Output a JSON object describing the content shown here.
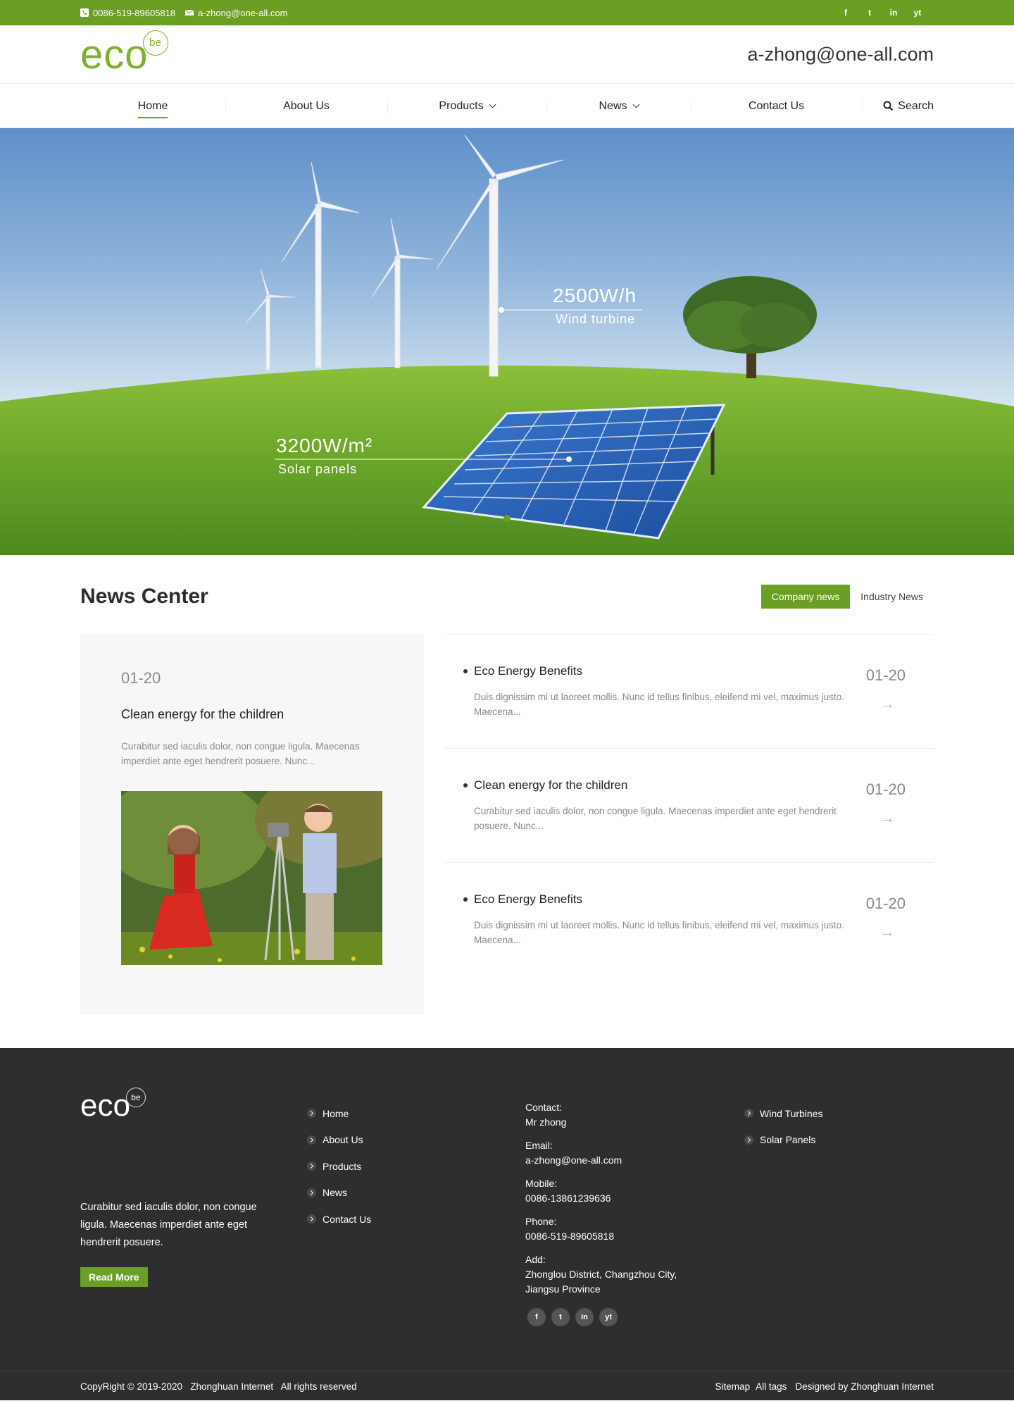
{
  "topbar": {
    "phone": "0086-519-89605818",
    "email": "a-zhong@one-all.com",
    "social": [
      "f",
      "t",
      "in",
      "yt"
    ]
  },
  "header": {
    "logo_main": "eco",
    "logo_badge": "be",
    "email": "a-zhong@one-all.com"
  },
  "nav": {
    "items": [
      {
        "label": "Home"
      },
      {
        "label": "About Us"
      },
      {
        "label": "Products"
      },
      {
        "label": "News"
      },
      {
        "label": "Contact Us"
      }
    ],
    "search_label": "Search"
  },
  "hero": {
    "wind_value": "2500W/h",
    "wind_caption": "Wind turbine",
    "solar_value": "3200W/m²",
    "solar_caption": "Solar panels"
  },
  "news": {
    "title": "News Center",
    "tabs": [
      {
        "label": "Company news"
      },
      {
        "label": "Industry News"
      }
    ],
    "featured": {
      "date": "01-20",
      "title": "Clean energy for the children",
      "desc": "Curabitur sed iaculis dolor, non congue ligula. Maecenas imperdiet ante eget hendrerit posuere. Nunc..."
    },
    "items": [
      {
        "title": "Eco Energy Benefits",
        "desc": "Duis dignissim mi ut laoreet mollis. Nunc id tellus finibus, eleifend mi vel, maximus justo. Maecena...",
        "date": "01-20",
        "arrow": "→"
      },
      {
        "title": "Clean energy for the children",
        "desc": "Curabitur sed iaculis dolor, non congue ligula. Maecenas imperdiet ante eget hendrerit posuere. Nunc...",
        "date": "01-20",
        "arrow": "→"
      },
      {
        "title": "Eco Energy Benefits",
        "desc": "Duis dignissim mi ut laoreet mollis. Nunc id tellus finibus, eleifend mi vel, maximus justo. Maecena...",
        "date": "01-20",
        "arrow": "→"
      }
    ]
  },
  "footer": {
    "logo_main": "eco",
    "logo_badge": "be",
    "about": "Curabitur sed iaculis dolor, non congue ligula. Maecenas imperdiet ante eget hendrerit posuere.",
    "read_more": "Read More",
    "links": [
      {
        "label": "Home"
      },
      {
        "label": "About Us"
      },
      {
        "label": "Products"
      },
      {
        "label": "News"
      },
      {
        "label": "Contact Us"
      }
    ],
    "contact": {
      "contact_label": "Contact:",
      "contact_value": "Mr zhong",
      "email_label": "Email:",
      "email_value": "a-zhong@one-all.com",
      "mobile_label": "Mobile:",
      "mobile_value": "0086-13861239636",
      "phone_label": "Phone:",
      "phone_value": "0086-519-89605818",
      "add_label": "Add:",
      "add_value": "Zhonglou District, Changzhou City, Jiangsu Province"
    },
    "social": [
      "f",
      "t",
      "in",
      "yt"
    ],
    "products": [
      {
        "label": "Wind Turbines"
      },
      {
        "label": "Solar Panels"
      }
    ],
    "copyright": "CopyRight © 2019-2020   Zhonghuan Internet   All rights reserved",
    "sitemap": "Sitemap",
    "all_tags": "All tags",
    "designed": "Designed by Zhonghuan Internet"
  },
  "colors": {
    "brand": "#6a9e24",
    "footer_bg": "#2e2e2e"
  }
}
